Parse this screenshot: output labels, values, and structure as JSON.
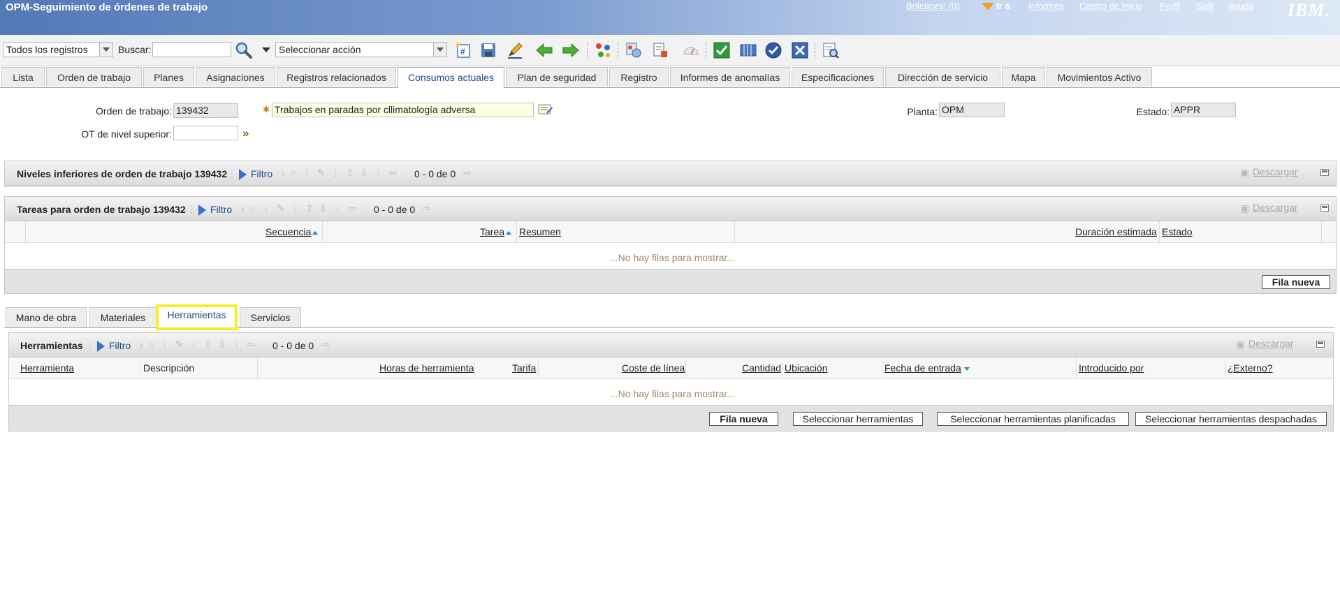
{
  "header": {
    "app_title": "OPM-Seguimiento de órdenes de trabajo",
    "boletines": "Boletines: (0)",
    "ir_a": "Ir a",
    "informes": "Informes",
    "centro_inicio": "Centro de inicio",
    "perfil": "Perfil",
    "salir": "Salir",
    "ayuda": "Ayuda",
    "logo": "IBM."
  },
  "toolbar": {
    "query_select": "Todos los registros",
    "search_label": "Buscar:",
    "search_value": "",
    "action_select": "Seleccionar acción"
  },
  "tabs": [
    {
      "label": "Lista"
    },
    {
      "label": "Orden de trabajo"
    },
    {
      "label": "Planes"
    },
    {
      "label": "Asignaciones"
    },
    {
      "label": "Registros relacionados"
    },
    {
      "label": "Consumos actuales",
      "active": true
    },
    {
      "label": "Plan de seguridad"
    },
    {
      "label": "Registro"
    },
    {
      "label": "Informes de anomalías"
    },
    {
      "label": "Especificaciones"
    },
    {
      "label": "Dirección de servicio"
    },
    {
      "label": "Mapa"
    },
    {
      "label": "Movimientos Activo"
    }
  ],
  "form": {
    "orden_label": "Orden de trabajo:",
    "orden_value": "139432",
    "descripcion_value": "Trabajos en paradas por cllimatología adversa",
    "ot_superior_label": "OT de nivel superior:",
    "ot_superior_value": "",
    "planta_label": "Planta:",
    "planta_value": "OPM",
    "estado_label": "Estado:",
    "estado_value": "APPR"
  },
  "niveles": {
    "title": "Niveles inferiores de orden de trabajo 139432",
    "filtro": "Filtro",
    "count": "0 - 0 de 0",
    "descargar": "Descargar"
  },
  "tareas": {
    "title": "Tareas para orden de trabajo 139432",
    "filtro": "Filtro",
    "count": "0 - 0 de 0",
    "descargar": "Descargar",
    "columns": {
      "secuencia": "Secuencia",
      "tarea": "Tarea",
      "resumen": "Resumen",
      "duracion": "Duración estimada",
      "estado": "Estado"
    },
    "no_rows": "...No hay filas para mostrar...",
    "new_row": "Fila nueva"
  },
  "subtabs": [
    {
      "label": "Mano de obra"
    },
    {
      "label": "Materiales"
    },
    {
      "label": "Herramientas",
      "active": true
    },
    {
      "label": "Servicios"
    }
  ],
  "herramientas": {
    "title": "Herramientas",
    "filtro": "Filtro",
    "count": "0 - 0 de 0",
    "descargar": "Descargar",
    "columns": {
      "herramienta": "Herramienta",
      "descripcion": "Descripción",
      "horas": "Horas de herramienta",
      "tarifa": "Tarifa",
      "coste": "Coste de línea",
      "cantidad": "Cantidad",
      "ubicacion": "Ubicación",
      "fecha": "Fecha de entrada",
      "introducido": "Introducido por",
      "externo": "¿Externo?"
    },
    "no_rows": "...No hay filas para mostrar...",
    "buttons": {
      "new_row": "Fila nueva",
      "select": "Seleccionar herramientas",
      "select_planned": "Seleccionar herramientas planificadas",
      "select_dispatched": "Seleccionar herramientas despachadas"
    }
  },
  "colors": {
    "header_blue": "#5379b6",
    "link_blue": "#1c4a8a",
    "highlight_yellow": "#f5ee28"
  }
}
